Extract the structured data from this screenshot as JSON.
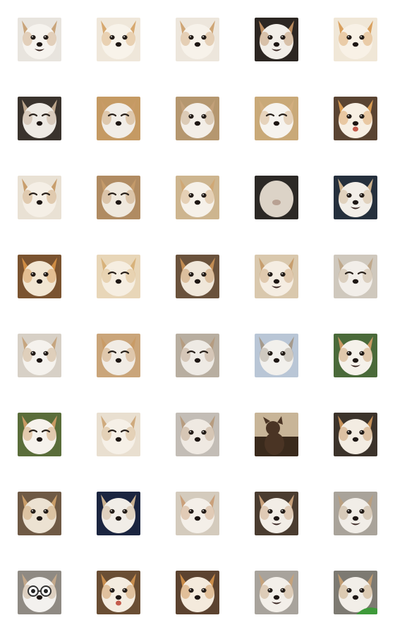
{
  "sticker_grid": {
    "columns": 5,
    "rows": 8,
    "items": [
      {
        "icon": "chihuahua-face-icon",
        "bg": "#e8e4de",
        "fur": "#f6f3ee",
        "accent": "#c9a47a",
        "mood": "open-mouth"
      },
      {
        "icon": "chihuahua-face-icon",
        "bg": "#efe7da",
        "fur": "#f8f3ea",
        "accent": "#d7a86f",
        "mood": "neutral"
      },
      {
        "icon": "chihuahua-face-icon",
        "bg": "#ede6dc",
        "fur": "#f7f2ea",
        "accent": "#cfa575",
        "mood": "neutral"
      },
      {
        "icon": "chihuahua-face-icon",
        "bg": "#2c2622",
        "fur": "#f2eee8",
        "accent": "#b98a5d",
        "mood": "smile"
      },
      {
        "icon": "chihuahua-face-icon",
        "bg": "#f0e7d7",
        "fur": "#f8f1e6",
        "accent": "#d9a05e",
        "mood": "neutral"
      },
      {
        "icon": "chihuahua-face-icon",
        "bg": "#3a332d",
        "fur": "#eeeae4",
        "accent": "#bca58c",
        "mood": "squint"
      },
      {
        "icon": "chihuahua-face-icon",
        "bg": "#c59a63",
        "fur": "#f1ede7",
        "accent": "#c89b67",
        "mood": "squint"
      },
      {
        "icon": "chihuahua-face-icon",
        "bg": "#b5976f",
        "fur": "#f3eee7",
        "accent": "#c2a079",
        "mood": "neutral"
      },
      {
        "icon": "chihuahua-face-icon",
        "bg": "#c9a978",
        "fur": "#f6f3ee",
        "accent": "#d2ae7f",
        "mood": "squint"
      },
      {
        "icon": "chihuahua-face-icon",
        "bg": "#5a4432",
        "fur": "#f7efe3",
        "accent": "#d79a52",
        "mood": "tongue"
      },
      {
        "icon": "chihuahua-face-icon",
        "bg": "#e9e1d4",
        "fur": "#f5efe6",
        "accent": "#c89e6d",
        "mood": "squint"
      },
      {
        "icon": "chihuahua-face-icon",
        "bg": "#b08b62",
        "fur": "#efe8dd",
        "accent": "#c49a6a",
        "mood": "squint"
      },
      {
        "icon": "chihuahua-face-icon",
        "bg": "#cdb58f",
        "fur": "#f6f1e9",
        "accent": "#d0a875",
        "mood": "neutral"
      },
      {
        "icon": "chihuahua-face-icon",
        "bg": "#2c2926",
        "fur": "#efe6d9",
        "accent": "#d2a56e",
        "mood": "blur"
      },
      {
        "icon": "chihuahua-face-icon",
        "bg": "#25303d",
        "fur": "#f2eee8",
        "accent": "#cbb08c",
        "mood": "open-mouth"
      },
      {
        "icon": "chihuahua-face-icon",
        "bg": "#7a5330",
        "fur": "#f2e6d2",
        "accent": "#d08d44",
        "mood": "neutral"
      },
      {
        "icon": "chihuahua-face-icon",
        "bg": "#e8d6b8",
        "fur": "#f6eee1",
        "accent": "#d8b27a",
        "mood": "sleepy"
      },
      {
        "icon": "chihuahua-face-icon",
        "bg": "#6a523c",
        "fur": "#f0e7da",
        "accent": "#c28c52",
        "mood": "neutral"
      },
      {
        "icon": "chihuahua-face-icon",
        "bg": "#d9c8ad",
        "fur": "#f5ede2",
        "accent": "#c79e6e",
        "mood": "smile"
      },
      {
        "icon": "chihuahua-face-icon",
        "bg": "#cfc8bd",
        "fur": "#f2eee9",
        "accent": "#bfa88b",
        "mood": "squint"
      },
      {
        "icon": "chihuahua-face-icon",
        "bg": "#d7d0c6",
        "fur": "#f5f2ed",
        "accent": "#c6a57f",
        "mood": "neutral"
      },
      {
        "icon": "chihuahua-face-icon",
        "bg": "#caa57a",
        "fur": "#f1ece5",
        "accent": "#c99b66",
        "mood": "squint"
      },
      {
        "icon": "chihuahua-face-icon",
        "bg": "#b8aea0",
        "fur": "#eeeae4",
        "accent": "#b59c80",
        "mood": "squint"
      },
      {
        "icon": "chihuahua-face-icon",
        "bg": "#b9c6d6",
        "fur": "#f2f0ec",
        "accent": "#a59a8c",
        "mood": "neutral"
      },
      {
        "icon": "chihuahua-face-icon",
        "bg": "#4a6a3a",
        "fur": "#f5f1ea",
        "accent": "#c79762",
        "mood": "smile"
      },
      {
        "icon": "chihuahua-face-icon",
        "bg": "#5a6d3a",
        "fur": "#f6f2ec",
        "accent": "#c99a63",
        "mood": "squint"
      },
      {
        "icon": "chihuahua-face-icon",
        "bg": "#e9dfd0",
        "fur": "#f6f0e7",
        "accent": "#cfaa7d",
        "mood": "squint"
      },
      {
        "icon": "chihuahua-face-icon",
        "bg": "#c3bdb6",
        "fur": "#efe9e2",
        "accent": "#b79c7f",
        "mood": "neutral"
      },
      {
        "icon": "chihuahua-photo-icon",
        "bg": "#5b4a38",
        "fur": "#4a3424",
        "accent": "#8a6848",
        "mood": "silhouette"
      },
      {
        "icon": "chihuahua-photo-icon",
        "bg": "#3c332b",
        "fur": "#f3ece2",
        "accent": "#c48f57",
        "mood": "neutral"
      },
      {
        "icon": "chihuahua-photo-icon",
        "bg": "#6f5a45",
        "fur": "#ece2d2",
        "accent": "#c99d68",
        "mood": "neutral"
      },
      {
        "icon": "chihuahua-photo-icon",
        "bg": "#1b2540",
        "fur": "#f1ede7",
        "accent": "#c9b08f",
        "mood": "neutral"
      },
      {
        "icon": "chihuahua-face-icon",
        "bg": "#d4cbbd",
        "fur": "#f4efe8",
        "accent": "#caa07a",
        "mood": "neutral"
      },
      {
        "icon": "chihuahua-photo-icon",
        "bg": "#4a3c30",
        "fur": "#f2ede6",
        "accent": "#c7a07a",
        "mood": "smile"
      },
      {
        "icon": "chihuahua-face-icon",
        "bg": "#a9a39a",
        "fur": "#f1ede7",
        "accent": "#b99f80",
        "mood": "open-mouth"
      },
      {
        "icon": "chihuahua-glasses-icon",
        "bg": "#8f8a83",
        "fur": "#f3f1ee",
        "accent": "#c3a88a",
        "mood": "glasses"
      },
      {
        "icon": "chihuahua-face-icon",
        "bg": "#6a4e34",
        "fur": "#f4ece0",
        "accent": "#c88d4d",
        "mood": "tongue"
      },
      {
        "icon": "chihuahua-face-icon",
        "bg": "#5c4330",
        "fur": "#f4eadc",
        "accent": "#c98b47",
        "mood": "neutral"
      },
      {
        "icon": "chihuahua-face-icon",
        "bg": "#a8a39c",
        "fur": "#f3efe9",
        "accent": "#c4a27c",
        "mood": "smile"
      },
      {
        "icon": "chihuahua-face-icon",
        "bg": "#7d7a72",
        "fur": "#f2eee8",
        "accent": "#c29d72",
        "mood": "leaf"
      }
    ]
  }
}
